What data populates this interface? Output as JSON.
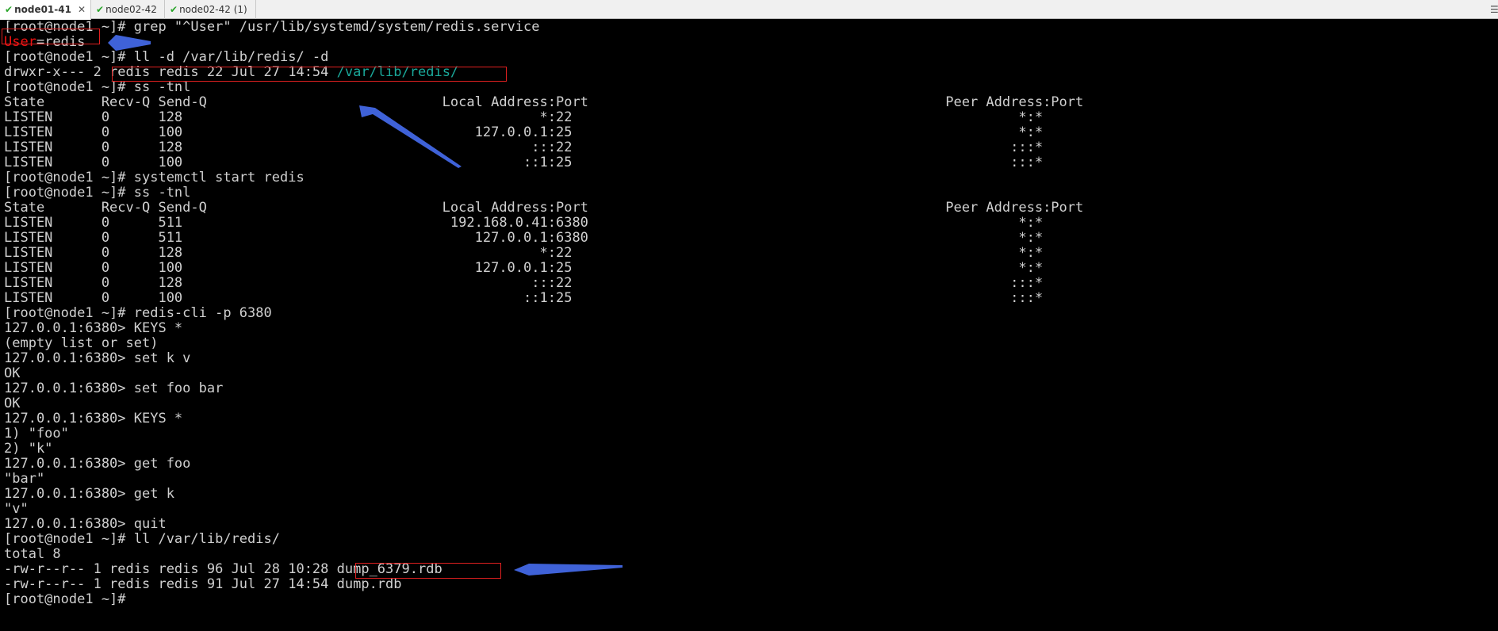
{
  "tabs": [
    {
      "label": "node01-41",
      "active": true,
      "status": "connected",
      "closable": true
    },
    {
      "label": "node02-42",
      "active": false,
      "status": "connected",
      "closable": false
    },
    {
      "label": "node02-42 (1)",
      "active": false,
      "status": "connected",
      "closable": false
    }
  ],
  "tab_close_glyph": "✕",
  "tab_check_glyph": "✔",
  "tab_overflow_glyph": "☰",
  "terminal": {
    "lines": [
      "[root@node1 ~]# grep \"^User\" /usr/lib/systemd/system/redis.service",
      "User=redis",
      "[root@node1 ~]# ll -d /var/lib/redis/ -d",
      "drwxr-x--- 2 redis redis 22 Jul 27 14:54 /var/lib/redis/",
      "[root@node1 ~]# ss -tnl",
      "State       Recv-Q Send-Q                             Local Address:Port                                            Peer Address:Port",
      "LISTEN      0      128                                            *:22                                                       *:*",
      "LISTEN      0      100                                    127.0.0.1:25                                                       *:*",
      "LISTEN      0      128                                           :::22                                                      :::*",
      "LISTEN      0      100                                          ::1:25                                                      :::*",
      "[root@node1 ~]# systemctl start redis",
      "[root@node1 ~]# ss -tnl",
      "State       Recv-Q Send-Q                             Local Address:Port                                            Peer Address:Port",
      "LISTEN      0      511                                 192.168.0.41:6380                                                     *:*",
      "LISTEN      0      511                                    127.0.0.1:6380                                                     *:*",
      "LISTEN      0      128                                            *:22                                                       *:*",
      "LISTEN      0      100                                    127.0.0.1:25                                                       *:*",
      "LISTEN      0      128                                           :::22                                                      :::*",
      "LISTEN      0      100                                          ::1:25                                                      :::*",
      "[root@node1 ~]# redis-cli -p 6380",
      "127.0.0.1:6380> KEYS *",
      "(empty list or set)",
      "127.0.0.1:6380> set k v",
      "OK",
      "127.0.0.1:6380> set foo bar",
      "OK",
      "127.0.0.1:6380> KEYS *",
      "1) \"foo\"",
      "2) \"k\"",
      "127.0.0.1:6380> get foo",
      "\"bar\"",
      "127.0.0.1:6380> get k",
      "\"v\"",
      "127.0.0.1:6380> quit",
      "[root@node1 ~]# ll /var/lib/redis/",
      "total 8",
      "-rw-r--r-- 1 redis redis 96 Jul 28 10:28 dump_6379.rdb",
      "-rw-r--r-- 1 redis redis 91 Jul 27 14:54 dump.rdb",
      "[root@node1 ~]#"
    ]
  },
  "colors": {
    "background": "#000000",
    "text": "#d0d0d0",
    "red_text": "#ee1111",
    "teal_text": "#1aa89a",
    "highlight_box": "#e02020",
    "arrow": "#3f62d8",
    "tab_check": "#2aa52a"
  }
}
